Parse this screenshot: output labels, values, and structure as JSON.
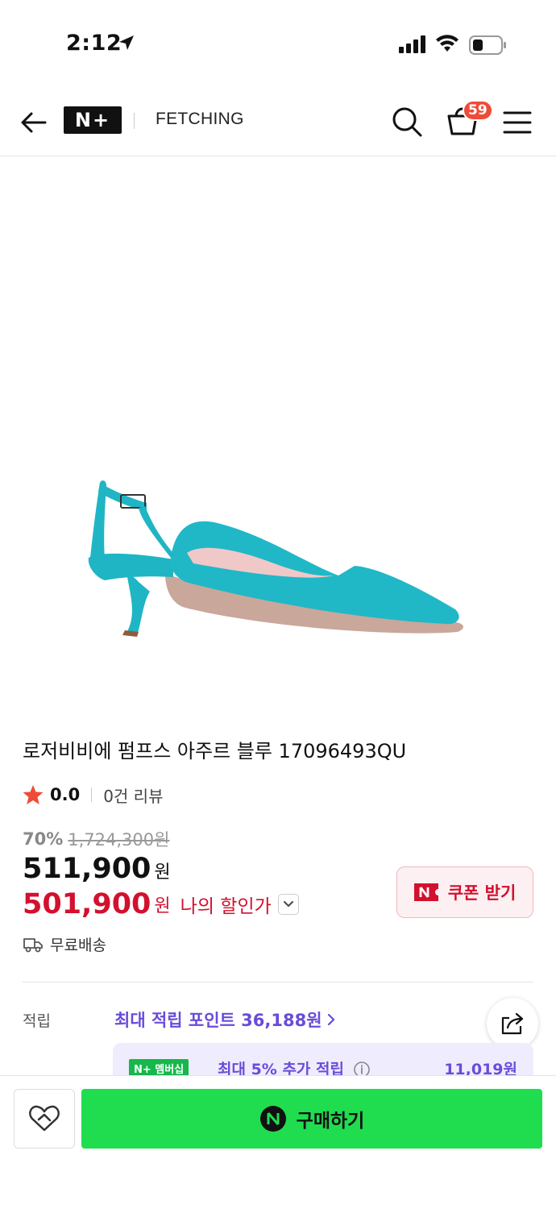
{
  "status_bar": {
    "time": "2:12"
  },
  "header": {
    "logo": "N+",
    "brand": "FETCHING",
    "cart_count": "59"
  },
  "product": {
    "title": "로저비비에 펌프스 아주르 블루 17096493QU",
    "rating": "0.0",
    "review_count": "0건 리뷰",
    "discount_rate": "70%",
    "original_price": "1,724,300원",
    "price": "511,900",
    "price_unit": "원",
    "my_price": "501,900",
    "my_price_unit": "원",
    "my_price_label": "나의 할인가",
    "shipping": "무료배송",
    "color": "#1fb5c4"
  },
  "coupon": {
    "label": "쿠폰 받기"
  },
  "points": {
    "label": "적립",
    "link": "최대 적립 포인트 36,188원"
  },
  "membership": {
    "badge": "N+ 멤버십",
    "text": "최대 5% 추가 적립",
    "amount": "11,019원"
  },
  "bottom_bar": {
    "buy_label": "구매하기"
  },
  "colors": {
    "price_red": "#d3102e",
    "point_purple": "#6a4cd8",
    "buy_green": "#1fdd4f",
    "badge_orange": "#f04b37"
  }
}
